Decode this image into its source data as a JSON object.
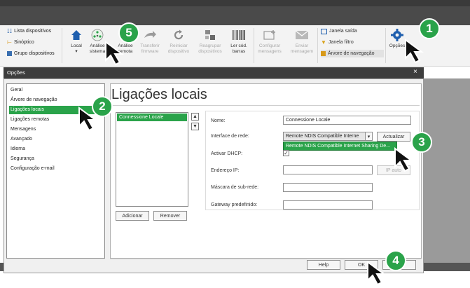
{
  "ribbon": {
    "list_items": [
      "Lista dispositivos",
      "Sinóptico",
      "Grupo dispositivos"
    ],
    "buttons": [
      {
        "label": "Local",
        "sub": "▾"
      },
      {
        "label": "Análise",
        "sub": "sistema"
      },
      {
        "label": "Análise",
        "sub": "remota"
      },
      {
        "label": "Transferir",
        "sub": "firmware"
      },
      {
        "label": "Reiniciar",
        "sub": "dispositivo"
      },
      {
        "label": "Reagrupar",
        "sub": "dispositivos"
      },
      {
        "label": "Ler cód.",
        "sub": "barras"
      },
      {
        "label": "Configurar",
        "sub": "mensagens"
      },
      {
        "label": "Enviar",
        "sub": "mensagem"
      }
    ],
    "view_items": [
      "Janela saída",
      "Janela filtro",
      "Árvore de navegação"
    ],
    "options_label": "Opções"
  },
  "dialog": {
    "title": "Opções",
    "close": "×",
    "nav_items": [
      "Geral",
      "Árvore de navegação",
      "Ligações locais",
      "Ligações remotas",
      "Mensagens",
      "Avançado",
      "Idioma",
      "Segurança",
      "Configuração e-mail"
    ],
    "selected_nav": 2,
    "page_title": "Ligações locais",
    "connections": [
      "Connessione Locale"
    ],
    "add_button": "Adicionar",
    "remove_button": "Remover",
    "form": {
      "name_label": "Nome:",
      "name_value": "Connessione Locale",
      "interface_label": "Interface de rede:",
      "interface_value": "Remote NDIS Compatible Interne",
      "interface_option": "Remote NDIS Compatible Internet Sharing De...",
      "update_button": "Actualizar",
      "dhcp_label": "Activar DHCP:",
      "dhcp_checked": true,
      "ip_label": "Endereço IP:",
      "ip_auto_button": "IP auto",
      "mask_label": "Máscara de sub-rede:",
      "gateway_label": "Gateway predefinido:"
    },
    "help_button": "Help",
    "ok_button": "OK"
  },
  "badges": [
    "1",
    "2",
    "3",
    "4",
    "5"
  ],
  "colors": {
    "accent": "#2aa34a",
    "titlebar": "#3d3d3d"
  }
}
